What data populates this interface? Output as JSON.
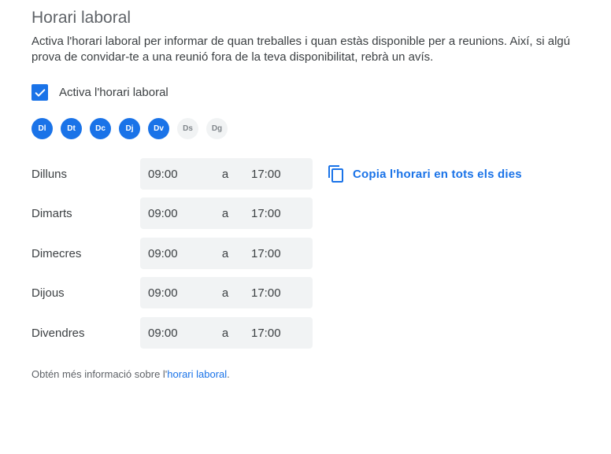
{
  "section": {
    "title": "Horari laboral",
    "description": "Activa l'horari laboral per informar de quan treballes i quan estàs disponible per a reunions. Així, si algú prova de convidar-te a una reunió fora de la teva disponibilitat, rebrà un avís."
  },
  "enable": {
    "checked": true,
    "label": "Activa l'horari laboral"
  },
  "days": [
    {
      "label": "Dl",
      "active": true
    },
    {
      "label": "Dt",
      "active": true
    },
    {
      "label": "Dc",
      "active": true
    },
    {
      "label": "Dj",
      "active": true
    },
    {
      "label": "Dv",
      "active": true
    },
    {
      "label": "Ds",
      "active": false
    },
    {
      "label": "Dg",
      "active": false
    }
  ],
  "schedule": [
    {
      "day": "Dilluns",
      "start": "09:00",
      "sep": "a",
      "end": "17:00"
    },
    {
      "day": "Dimarts",
      "start": "09:00",
      "sep": "a",
      "end": "17:00"
    },
    {
      "day": "Dimecres",
      "start": "09:00",
      "sep": "a",
      "end": "17:00"
    },
    {
      "day": "Dijous",
      "start": "09:00",
      "sep": "a",
      "end": "17:00"
    },
    {
      "day": "Divendres",
      "start": "09:00",
      "sep": "a",
      "end": "17:00"
    }
  ],
  "copy_action": {
    "label": "Copia l'horari en tots els dies",
    "icon": "copy-icon"
  },
  "footer": {
    "prefix": "Obtén més informació sobre l'",
    "link": "horari laboral",
    "suffix": "."
  },
  "colors": {
    "accent": "#1a73e8",
    "field_bg": "#f1f3f4",
    "inactive_day_bg": "#f1f3f4"
  }
}
